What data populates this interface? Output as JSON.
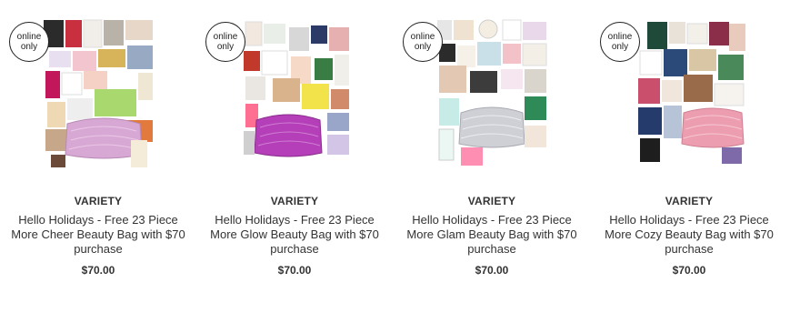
{
  "products": [
    {
      "badge": "online\nonly",
      "brand": "VARIETY",
      "title": "Hello Holidays - Free 23 Piece More Cheer Beauty Bag with $70 purchase",
      "price": "$70.00",
      "bag_color": "#d8a8d4"
    },
    {
      "badge": "online\nonly",
      "brand": "VARIETY",
      "title": "Hello Holidays - Free 23 Piece More Glow Beauty Bag with $70 purchase",
      "price": "$70.00",
      "bag_color": "#b43fb8"
    },
    {
      "badge": "online\nonly",
      "brand": "VARIETY",
      "title": "Hello Holidays - Free 23 Piece More Glam Beauty Bag with $70 purchase",
      "price": "$70.00",
      "bag_color": "#cfd0d6"
    },
    {
      "badge": "online\nonly",
      "brand": "VARIETY",
      "title": "Hello Holidays - Free 23 Piece More Cozy Beauty Bag with $70 purchase",
      "price": "$70.00",
      "bag_color": "#ec9eb0"
    }
  ]
}
